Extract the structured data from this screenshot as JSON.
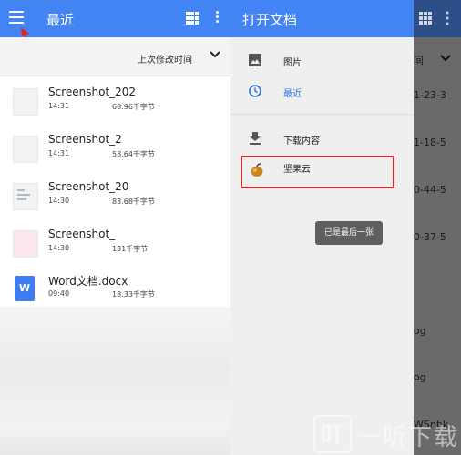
{
  "left": {
    "title": "最近",
    "sort_label": "上次修改时间",
    "files": [
      {
        "name": "Screenshot_202",
        "time": "14:31",
        "size": "68.96千字节"
      },
      {
        "name": "Screenshot_2",
        "time": "14:31",
        "size": "58.64千字节"
      },
      {
        "name": "Screenshot_20",
        "time": "14:30",
        "size": "83.68千字节"
      },
      {
        "name": "Screenshot_",
        "time": "14:30",
        "size": "131千字节"
      },
      {
        "name": "Word文档.docx",
        "time": "09:40",
        "size": "18.33千字节",
        "icon_letter": "W"
      }
    ]
  },
  "right": {
    "drawer_title": "打开文档",
    "nav_items": [
      {
        "label": "图片",
        "icon": "image-icon"
      },
      {
        "label": "最近",
        "icon": "clock-icon",
        "active": true
      },
      {
        "label": "下载内容",
        "icon": "download-icon"
      },
      {
        "label": "坚果云",
        "icon": "nut-cloud-icon"
      }
    ],
    "toast": "已是最后一张",
    "background_fragments": [
      "间",
      "1-23-3",
      "1-18-5",
      "0-44-5",
      "0-37-5",
      "og",
      "og",
      "WSnbk"
    ]
  },
  "watermark": {
    "text": "一听下载"
  },
  "colors": {
    "appbar_blue": "#4284f3",
    "accent": "#2d6ee8",
    "highlight_red": "#d12a35"
  }
}
